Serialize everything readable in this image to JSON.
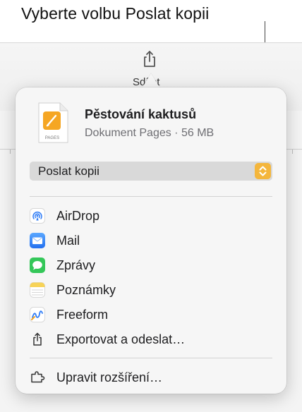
{
  "callout": {
    "text": "Vyberte volbu Poslat kopii"
  },
  "toolbar": {
    "share_label": "Sdílet"
  },
  "document": {
    "title": "Pěstování kaktusů",
    "meta": "Dokument Pages · 56 MB",
    "icon_caption": "PAGES"
  },
  "send_select": {
    "value": "Poslat kopii"
  },
  "share_items": [
    {
      "label": "AirDrop",
      "icon": "airdrop-icon"
    },
    {
      "label": "Mail",
      "icon": "mail-icon"
    },
    {
      "label": "Zprávy",
      "icon": "messages-icon"
    },
    {
      "label": "Poznámky",
      "icon": "notes-icon"
    },
    {
      "label": "Freeform",
      "icon": "freeform-icon"
    },
    {
      "label": "Exportovat a odeslat…",
      "icon": "export-icon"
    }
  ],
  "footer": {
    "label": "Upravit rozšíření…",
    "icon": "extensions-icon"
  },
  "colors": {
    "accent": "#f4b63c",
    "pages_orange": "#f5a623",
    "mail_blue": "#3f8cf5",
    "messages_green": "#34c759",
    "notes_yellow": "#f7d358"
  }
}
